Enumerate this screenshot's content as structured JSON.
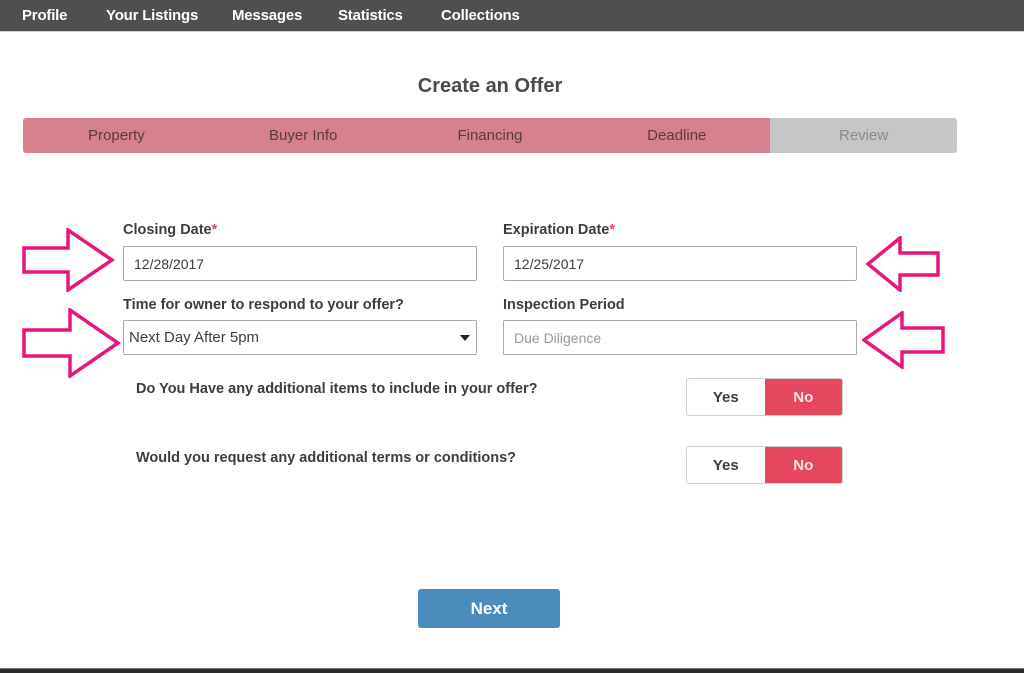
{
  "nav": {
    "items": [
      {
        "label": "Profile"
      },
      {
        "label": "Your Listings"
      },
      {
        "label": "Messages"
      },
      {
        "label": "Statistics"
      },
      {
        "label": "Collections"
      }
    ]
  },
  "page": {
    "title": "Create an Offer"
  },
  "steps": [
    {
      "label": "Property",
      "state": "complete"
    },
    {
      "label": "Buyer Info",
      "state": "complete"
    },
    {
      "label": "Financing",
      "state": "complete"
    },
    {
      "label": "Deadline",
      "state": "complete"
    },
    {
      "label": "Review",
      "state": "pending"
    }
  ],
  "form": {
    "closing_date": {
      "label": "Closing Date",
      "required_mark": "*",
      "value": "12/28/2017"
    },
    "expiration_date": {
      "label": "Expiration Date",
      "required_mark": "*",
      "value": "12/25/2017"
    },
    "response_time": {
      "label": "Time for owner to respond to your offer?",
      "selected": "Next Day After 5pm"
    },
    "inspection_period": {
      "label": "Inspection Period",
      "value": "",
      "placeholder": "Due Diligence"
    },
    "questions": [
      {
        "text": "Do You Have any additional items to include in your offer?",
        "yes_label": "Yes",
        "no_label": "No",
        "selected": "No"
      },
      {
        "text": "Would you request any additional terms or conditions?",
        "yes_label": "Yes",
        "no_label": "No",
        "selected": "No"
      }
    ]
  },
  "actions": {
    "next_label": "Next"
  },
  "colors": {
    "nav_bg": "#4d4f50",
    "step_complete": "#d6818c",
    "step_pending": "#c6c6c6",
    "toggle_active": "#e5475f",
    "primary_button": "#4b8cbc",
    "annotation_arrow": "#e8157f"
  }
}
